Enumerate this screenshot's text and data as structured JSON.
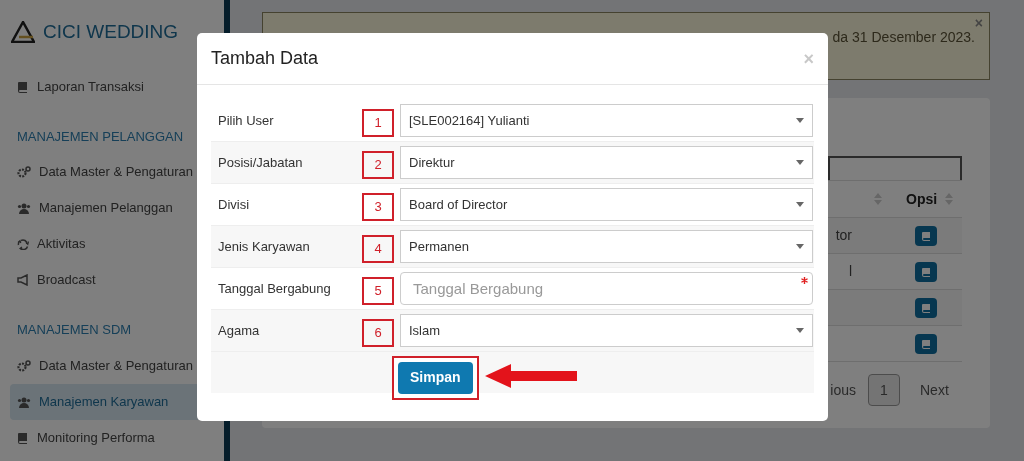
{
  "sidebar": {
    "brand": "CICI WEDDING",
    "items": [
      {
        "kind": "item",
        "label": "Laporan Transaksi",
        "selected": false
      },
      {
        "kind": "heading",
        "label": "MANAJEMEN PELANGGAN"
      },
      {
        "kind": "item",
        "label": "Data Master & Pengaturan",
        "selected": false
      },
      {
        "kind": "item",
        "label": "Manajemen Pelanggan",
        "selected": false
      },
      {
        "kind": "item",
        "label": "Aktivitas",
        "selected": false
      },
      {
        "kind": "item",
        "label": "Broadcast",
        "selected": false
      },
      {
        "kind": "heading",
        "label": "MANAJEMEN SDM"
      },
      {
        "kind": "item",
        "label": "Data Master & Pengaturan",
        "selected": false
      },
      {
        "kind": "item",
        "label": "Manajemen Karyawan",
        "selected": true
      },
      {
        "kind": "item",
        "label": "Monitoring Performa",
        "selected": false
      }
    ]
  },
  "alert": {
    "text": "da 31 Desember 2023.",
    "close": "×"
  },
  "table": {
    "column_header": "Opsi",
    "rows": [
      {
        "column_1": "tor"
      },
      {
        "column_1": "l"
      },
      {},
      {}
    ]
  },
  "pagination": {
    "previous": "ious",
    "page": "1",
    "next": "Next"
  },
  "modal": {
    "title": "Tambah Data",
    "close": "×",
    "fields": [
      {
        "kind": "select",
        "label": "Pilih User",
        "value": "[SLE002164] Yulianti",
        "annotation": "1"
      },
      {
        "kind": "select",
        "label": "Posisi/Jabatan",
        "value": "Direktur",
        "annotation": "2"
      },
      {
        "kind": "select",
        "label": "Divisi",
        "value": "Board of Director",
        "annotation": "3"
      },
      {
        "kind": "select",
        "label": "Jenis Karyawan",
        "value": "Permanen",
        "annotation": "4"
      },
      {
        "kind": "date",
        "label": "Tanggal Bergabung",
        "placeholder": "Tanggal Bergabung",
        "required": true,
        "annotation": "5"
      },
      {
        "kind": "select",
        "label": "Agama",
        "value": "Islam",
        "annotation": "6"
      }
    ],
    "submit": "Simpan"
  }
}
